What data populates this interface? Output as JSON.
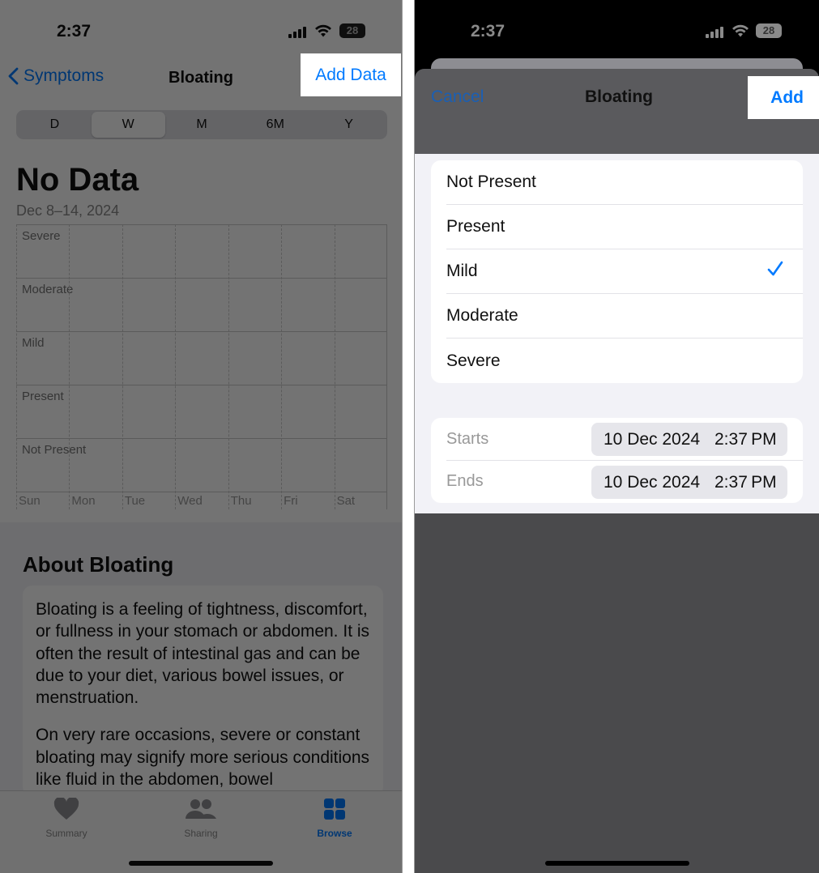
{
  "left": {
    "status": {
      "time": "2:37",
      "battery": "28"
    },
    "nav": {
      "back_label": "Symptoms",
      "title": "Bloating",
      "add_data_label": "Add Data"
    },
    "segments": [
      "D",
      "W",
      "M",
      "6M",
      "Y"
    ],
    "selected_segment": "W",
    "summary": {
      "value": "No Data",
      "date_range": "Dec 8–14, 2024"
    },
    "chart_data": {
      "type": "scatter",
      "categories": [
        "Sun",
        "Mon",
        "Tue",
        "Wed",
        "Thu",
        "Fri",
        "Sat"
      ],
      "y_levels": [
        "Severe",
        "Moderate",
        "Mild",
        "Present",
        "Not Present"
      ],
      "values": []
    },
    "about": {
      "title": "About Bloating",
      "paragraphs": [
        "Bloating is a feeling of tightness, discomfort, or fullness in your stomach or abdomen. It is often the result of intestinal gas and can be due to your diet, various bowel issues, or menstruation.",
        "On very rare occasions, severe or constant bloating may signify more serious conditions like fluid in the abdomen, bowel"
      ]
    },
    "tabs": [
      {
        "label": "Summary",
        "icon": "heart-icon"
      },
      {
        "label": "Sharing",
        "icon": "people-icon"
      },
      {
        "label": "Browse",
        "icon": "grid-icon"
      }
    ],
    "active_tab": "Browse"
  },
  "right": {
    "status": {
      "time": "2:37",
      "battery": "28"
    },
    "sheet": {
      "cancel_label": "Cancel",
      "title": "Bloating",
      "add_label": "Add"
    },
    "options": [
      "Not Present",
      "Present",
      "Mild",
      "Moderate",
      "Severe"
    ],
    "selected_option": "Mild",
    "starts": {
      "label": "Starts",
      "date": "10 Dec 2024",
      "time": "2:37 PM"
    },
    "ends": {
      "label": "Ends",
      "date": "10 Dec 2024",
      "time": "2:37 PM"
    }
  },
  "colors": {
    "accent": "#007aff",
    "overlay": "rgba(0,0,0,0.55)"
  }
}
